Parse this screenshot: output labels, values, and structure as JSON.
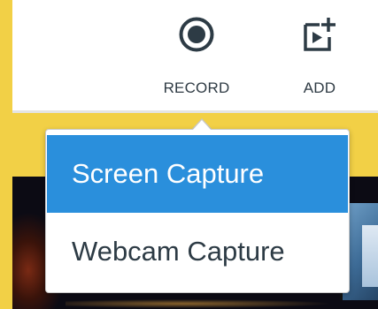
{
  "toolbar": {
    "record": {
      "label": "RECORD",
      "icon": "record-icon"
    },
    "add": {
      "label": "ADD",
      "icon": "add-media-icon"
    }
  },
  "menu": {
    "items": [
      {
        "label": "Screen Capture",
        "selected": true
      },
      {
        "label": "Webcam Capture",
        "selected": false
      }
    ]
  },
  "colors": {
    "accent": "#2a8fdc",
    "text": "#2d3b45",
    "background": "#f2d046"
  }
}
